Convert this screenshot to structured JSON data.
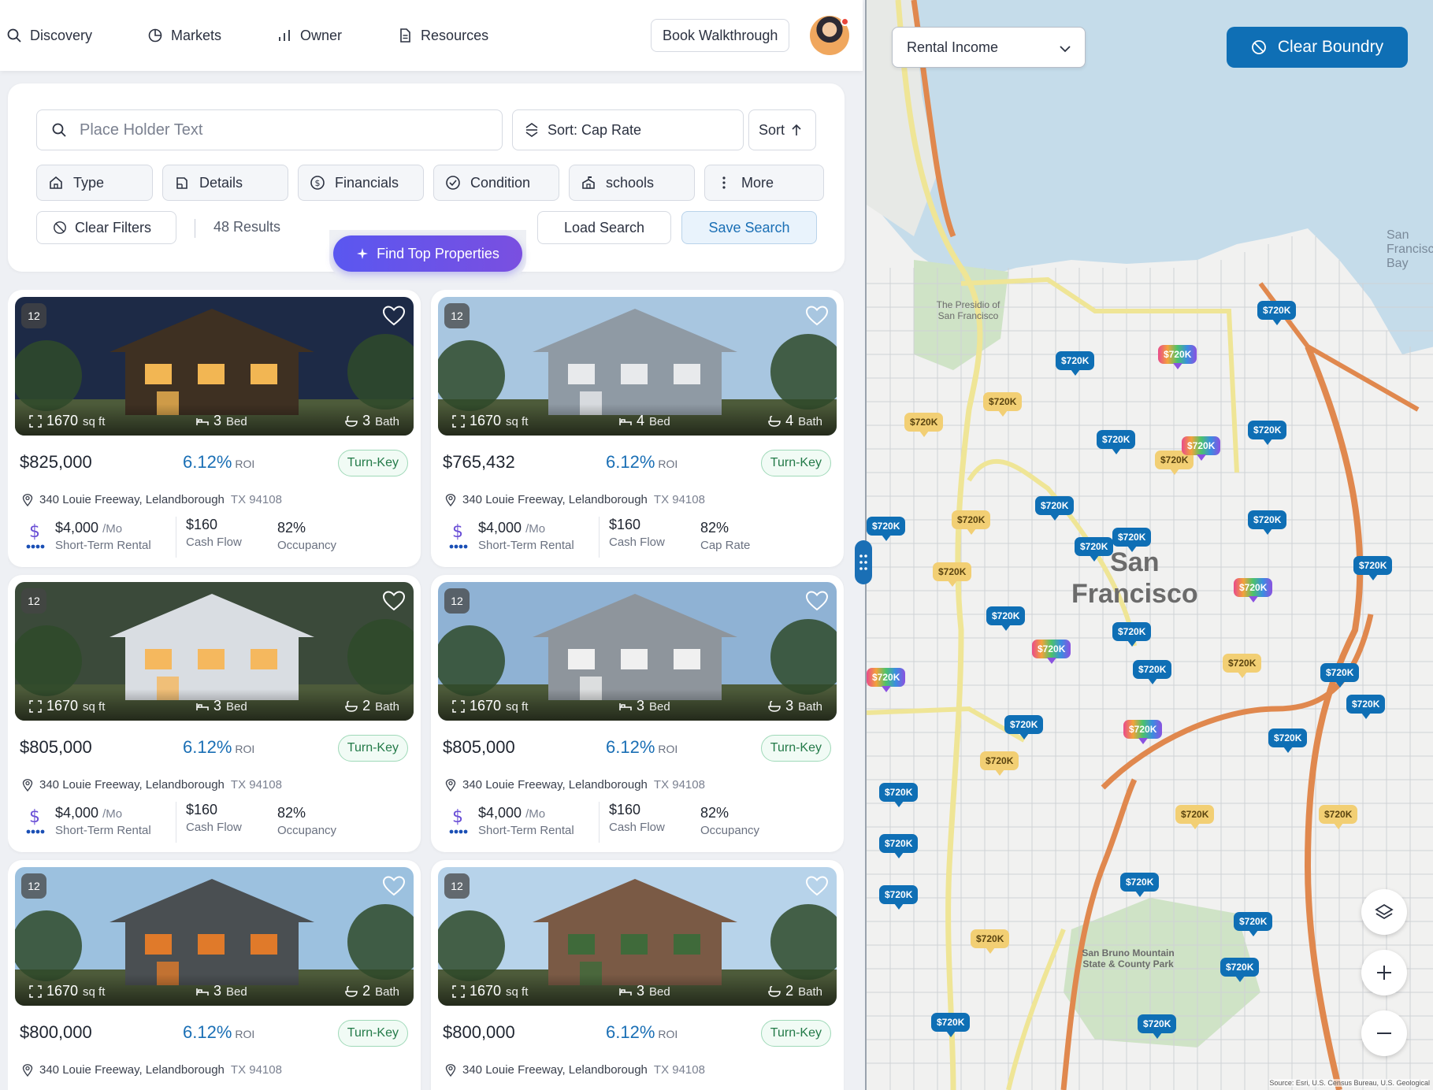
{
  "nav": {
    "items": [
      {
        "label": "Discovery",
        "icon": "search-icon"
      },
      {
        "label": "Markets",
        "icon": "pie-chart-icon"
      },
      {
        "label": "Owner",
        "icon": "bar-chart-icon"
      },
      {
        "label": "Resources",
        "icon": "document-icon"
      }
    ],
    "walkthrough_label": "Book Walkthrough"
  },
  "search": {
    "placeholder": "Place Holder Text",
    "sort_label": "Sort: Cap Rate",
    "sort_button": "Sort",
    "filters": [
      {
        "label": "Type",
        "icon": "home-icon"
      },
      {
        "label": "Details",
        "icon": "blueprint-icon"
      },
      {
        "label": "Financials",
        "icon": "dollar-circle-icon"
      },
      {
        "label": "Condition",
        "icon": "check-circle-icon"
      },
      {
        "label": "schools",
        "icon": "school-icon"
      },
      {
        "label": "More",
        "icon": "more-vertical-icon"
      }
    ],
    "clear_filters": "Clear Filters",
    "results": "48 Results",
    "load_search": "Load Search",
    "save_search": "Save Search",
    "find_top": "Find Top Properties"
  },
  "cards": [
    {
      "photos": "12",
      "sqft": "1670",
      "sqft_unit": "sq ft",
      "beds": "3",
      "bed_label": "Bed",
      "baths": "3",
      "bath_label": "Bath",
      "price": "$825,000",
      "roi": "6.12%",
      "roi_label": "ROI",
      "tag": "Turn-Key",
      "address": "340 Louie Freeway, Lelandborough",
      "zip": "TX 94108",
      "income": "$4,000",
      "income_unit": "/Mo",
      "income_label": "Short-Term Rental",
      "cash": "$160",
      "cash_label": "Cash Flow",
      "rate": "82%",
      "rate_label": "Occupancy"
    },
    {
      "photos": "12",
      "sqft": "1670",
      "sqft_unit": "sq ft",
      "beds": "4",
      "bed_label": "Bed",
      "baths": "4",
      "bath_label": "Bath",
      "price": "$765,432",
      "roi": "6.12%",
      "roi_label": "ROI",
      "tag": "Turn-Key",
      "address": "340 Louie Freeway, Lelandborough",
      "zip": "TX 94108",
      "income": "$4,000",
      "income_unit": "/Mo",
      "income_label": "Short-Term Rental",
      "cash": "$160",
      "cash_label": "Cash Flow",
      "rate": "82%",
      "rate_label": "Cap Rate"
    },
    {
      "photos": "12",
      "sqft": "1670",
      "sqft_unit": "sq ft",
      "beds": "3",
      "bed_label": "Bed",
      "baths": "2",
      "bath_label": "Bath",
      "price": "$805,000",
      "roi": "6.12%",
      "roi_label": "ROI",
      "tag": "Turn-Key",
      "address": "340 Louie Freeway, Lelandborough",
      "zip": "TX 94108",
      "income": "$4,000",
      "income_unit": "/Mo",
      "income_label": "Short-Term Rental",
      "cash": "$160",
      "cash_label": "Cash Flow",
      "rate": "82%",
      "rate_label": "Occupancy"
    },
    {
      "photos": "12",
      "sqft": "1670",
      "sqft_unit": "sq ft",
      "beds": "3",
      "bed_label": "Bed",
      "baths": "3",
      "bath_label": "Bath",
      "price": "$805,000",
      "roi": "6.12%",
      "roi_label": "ROI",
      "tag": "Turn-Key",
      "address": "340 Louie Freeway, Lelandborough",
      "zip": "TX 94108",
      "income": "$4,000",
      "income_unit": "/Mo",
      "income_label": "Short-Term Rental",
      "cash": "$160",
      "cash_label": "Cash Flow",
      "rate": "82%",
      "rate_label": "Occupancy"
    },
    {
      "photos": "12",
      "sqft": "1670",
      "sqft_unit": "sq ft",
      "beds": "3",
      "bed_label": "Bed",
      "baths": "2",
      "bath_label": "Bath",
      "price": "$800,000",
      "roi": "6.12%",
      "roi_label": "ROI",
      "tag": "Turn-Key",
      "address": "340 Louie Freeway, Lelandborough",
      "zip": "TX 94108"
    },
    {
      "photos": "12",
      "sqft": "1670",
      "sqft_unit": "sq ft",
      "beds": "3",
      "bed_label": "Bed",
      "baths": "2",
      "bath_label": "Bath",
      "price": "$800,000",
      "roi": "6.12%",
      "roi_label": "ROI",
      "tag": "Turn-Key",
      "address": "340 Louie Freeway, Lelandborough",
      "zip": "TX 94108"
    }
  ],
  "map": {
    "layer_select": "Rental Income",
    "clear_boundary": "Clear Boundry",
    "city_label_1": "San",
    "city_label_2": "Francisco",
    "pin_label": "$720K",
    "place_labels": [
      "The Presidio of San Francisco",
      "San Bruno Mountain State & County Park",
      "San Francisco Bay"
    ],
    "attribution": "Source: Esri, U.S. Census Bureau, U.S. Geological"
  },
  "colors": {
    "accent": "#0f6fb5",
    "roi": "#1a6fb5",
    "turnkey": "#237a48",
    "find_gradient_start": "#5a57f0",
    "find_gradient_end": "#7a4fe0",
    "pin_blue": "#0f6fb5",
    "pin_yellow": "#f2cf74"
  }
}
